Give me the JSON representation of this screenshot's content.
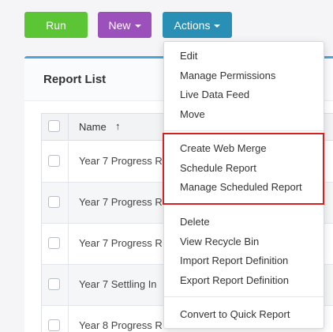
{
  "toolbar": {
    "run_label": "Run",
    "new_label": "New",
    "actions_label": "Actions"
  },
  "panel": {
    "title": "Report List"
  },
  "table": {
    "column_name": "Name",
    "sort_indicator": "↑",
    "rows": [
      "Year 7 Progress R",
      "Year 7 Progress R",
      "Year 7 Progress R",
      "Year 7 Settling In",
      "Year 8 Progress R"
    ]
  },
  "actions_menu": {
    "items": [
      "Edit",
      "Manage Permissions",
      "Live Data Feed",
      "Move",
      "Create Web Merge",
      "Schedule Report",
      "Manage Scheduled Report",
      "Delete",
      "View Recycle Bin",
      "Import Report Definition",
      "Export Report Definition",
      "Convert to Quick Report"
    ]
  },
  "colors": {
    "run": "#5cc535",
    "new": "#9b50bb",
    "actions": "#2a8fb4",
    "highlight": "#d32121"
  }
}
